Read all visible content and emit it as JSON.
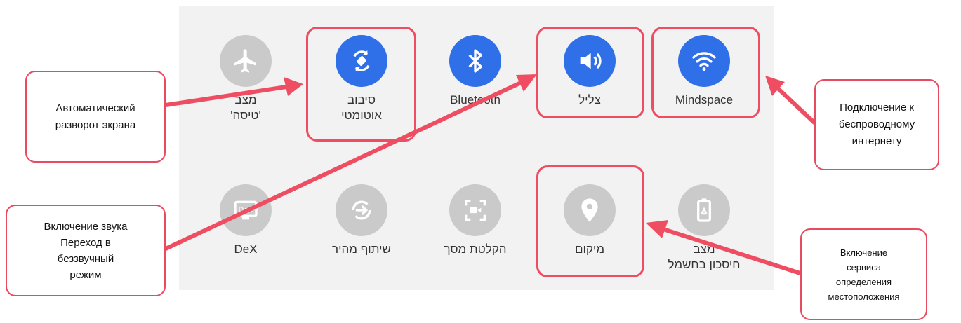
{
  "tiles_row1": [
    {
      "label": "מצב\n'טיסה'",
      "icon": "airplane-icon",
      "state": "off"
    },
    {
      "label": "סיבוב\nאוטומטי",
      "icon": "auto-rotate-icon",
      "state": "on"
    },
    {
      "label": "Bluetooth",
      "icon": "bluetooth-icon",
      "state": "on"
    },
    {
      "label": "צליל",
      "icon": "sound-icon",
      "state": "on"
    },
    {
      "label": "Mindspace",
      "icon": "wifi-icon",
      "state": "on"
    }
  ],
  "tiles_row2": [
    {
      "label": "DeX",
      "icon": "dex-icon",
      "state": "off"
    },
    {
      "label": "שיתוף מהיר",
      "icon": "quick-share-icon",
      "state": "off"
    },
    {
      "label": "הקלטת מסך",
      "icon": "screen-record-icon",
      "state": "off"
    },
    {
      "label": "מיקום",
      "icon": "location-icon",
      "state": "off"
    },
    {
      "label": "מצב\nחיסכון בחשמל",
      "icon": "power-saving-icon",
      "state": "off"
    }
  ],
  "callouts": {
    "auto_rotate": "Автоматический\nразворот экрана",
    "sound": "Включение звука\nПереход в\nбеззвучный\nрежим",
    "wifi": "Подключение к\nбеспроводному\nинтернету",
    "location": "Включение\nсервиса\nопределения\nместоположения"
  },
  "colors": {
    "accent": "#2f6fe8",
    "highlight": "#ee4d62",
    "inactive": "#cacaca",
    "panel": "#f2f2f2"
  }
}
